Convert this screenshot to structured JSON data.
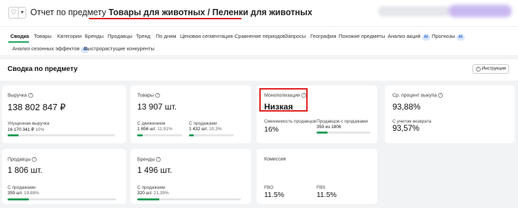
{
  "header": {
    "title_prefix": "Отчет по предмету ",
    "title_subject": "Товары для животных / Пеленки для животных",
    "fav_icon": "heart-icon",
    "menu_icon": "chevron-down-icon"
  },
  "tabs": [
    {
      "label": "Сводка",
      "active": true
    },
    {
      "label": "Товары"
    },
    {
      "label": "Категории"
    },
    {
      "label": "Бренды"
    },
    {
      "label": "Продавцы"
    },
    {
      "label": "Тренд"
    },
    {
      "label": "По дням"
    },
    {
      "label": "Ценовая сегментация"
    },
    {
      "label": "Сравнение периодов"
    },
    {
      "label": "Запросы"
    },
    {
      "label": "География"
    },
    {
      "label": "Похожие предметы"
    },
    {
      "label": "Анализ акций",
      "badge": "AI"
    },
    {
      "label": "Прогнозы",
      "badge": "AI"
    },
    {
      "label": "Анализ сезонных эффектов",
      "badge": "AI"
    },
    {
      "label": "Быстрорастущие конкуренты"
    }
  ],
  "summary": {
    "title": "Сводка по предмету",
    "instruction_button": "Инструкция"
  },
  "cards": {
    "revenue": {
      "label": "Выручка",
      "value": "138 802 847 ₽",
      "lost_label": "Упущенная выручка",
      "lost_value": "16 170 341 ₽",
      "lost_pct": "10%",
      "lost_fill": 0.1
    },
    "products": {
      "label": "Товары",
      "value": "13 907 шт.",
      "moving_label": "С движением",
      "moving_value": "1 656 шт.",
      "moving_pct": "11,91%",
      "moving_fill": 0.1191,
      "sales_label": "С продажами",
      "sales_value": "1 432 шт.",
      "sales_pct": "10,3%",
      "sales_fill": 0.103
    },
    "monopoly": {
      "label": "Монополизация",
      "value": "Низкая",
      "turnover_label": "Сменяемость продавцов",
      "turnover_value": "16%",
      "sellers_sales_label": "Продавцов с продажами",
      "sellers_sales_value": "359 из 1806",
      "sellers_fill": 0.1988
    },
    "buyout": {
      "label": "Ср. процент выкупа",
      "value": "93,88%",
      "return_label": "С учетом возврата",
      "return_value": "93,57%"
    },
    "sellers": {
      "label": "Продавцы",
      "value": "1 806 шт.",
      "sales_label": "С продажами",
      "sales_value": "359 шт.",
      "sales_pct": "19,88%",
      "sales_fill": 0.1988
    },
    "brands": {
      "label": "Бренды",
      "value": "1 496 шт.",
      "sales_label": "С продажами",
      "sales_value": "320 шт.",
      "sales_pct": "21,39%",
      "sales_fill": 0.2139
    },
    "commission": {
      "label": "Комиссия",
      "fbo_label": "FBO",
      "fbo_value": "11.5%",
      "fbs_label": "FBS",
      "fbs_value": "11.5%"
    }
  },
  "colors": {
    "accent_green": "#1d9d57",
    "highlight_red": "#e01b1b",
    "ai_badge": "#d9e6fb"
  }
}
